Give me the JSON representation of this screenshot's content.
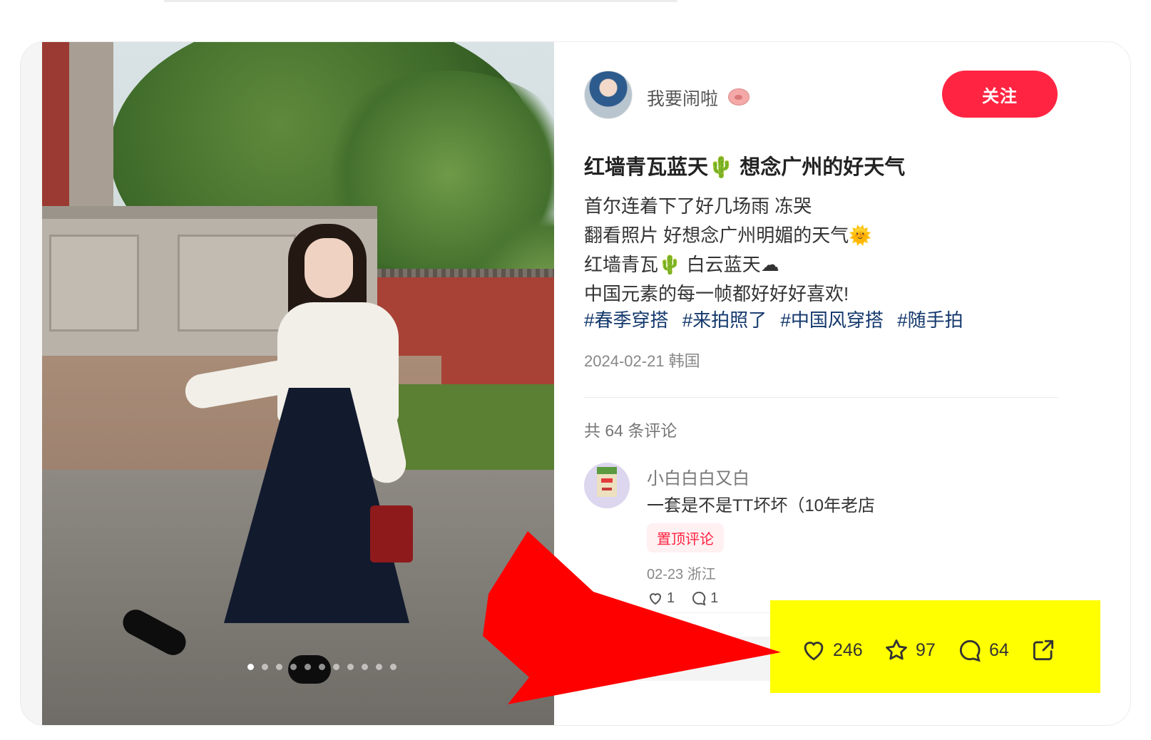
{
  "author": {
    "name": "我要闹啦"
  },
  "follow_label": "关注",
  "note": {
    "title": "红墙青瓦蓝天🌵 想念广州的好天气",
    "title_text": "红墙青瓦蓝天",
    "title_rest": "想念广州的好天气",
    "body_lines": [
      "首尔连着下了好几场雨 冻哭",
      "翻看照片 好想念广州明媚的天气",
      "红墙青瓦",
      "白云蓝天",
      "中国元素的每一帧都好好好喜欢!"
    ],
    "tags": [
      "#春季穿搭",
      "#来拍照了",
      "#中国风穿搭",
      "#随手拍"
    ],
    "date_location": "2024-02-21 韩国"
  },
  "comments": {
    "count_label": "共 64 条评论",
    "items": [
      {
        "name": "小白白白又白",
        "text": "一套是不是TT坏坏（10年老店",
        "badge": "置顶评论",
        "meta": "02-23 浙江",
        "likes": "1",
        "replies": "1"
      }
    ]
  },
  "engagement": {
    "likes": "246",
    "collects": "97",
    "comments": "64"
  },
  "carousel": {
    "total": 11,
    "active": 0
  },
  "colors": {
    "brand": "#ff2442",
    "tag": "#13386c",
    "highlight": "#ffff00",
    "arrow": "#ff0000"
  }
}
